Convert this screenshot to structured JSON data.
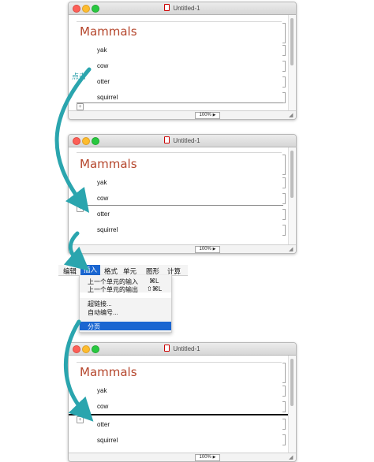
{
  "window_title": "Untitled-1",
  "zoom_level": "100%",
  "cells": {
    "title": "Mammals",
    "items": [
      "yak",
      "cow",
      "otter",
      "squirrel"
    ]
  },
  "annotation": "点击",
  "menubar": {
    "items": [
      "编辑",
      "插入",
      "格式",
      "单元",
      "图形",
      "计算"
    ],
    "active": "插入"
  },
  "insert_menu": {
    "items": [
      {
        "label": "上一个单元的输入",
        "shortcut": "⌘L"
      },
      {
        "label": "上一个单元的输出",
        "shortcut": "⇧⌘L"
      },
      {
        "label": "超链接...",
        "shortcut": ""
      },
      {
        "label": "自动编号...",
        "shortcut": ""
      },
      {
        "label": "分页",
        "shortcut": ""
      }
    ]
  },
  "colors": {
    "title_color": "#b5462c",
    "arrow_color": "#2aa5ae",
    "menu_highlight": "#1a66d1"
  }
}
